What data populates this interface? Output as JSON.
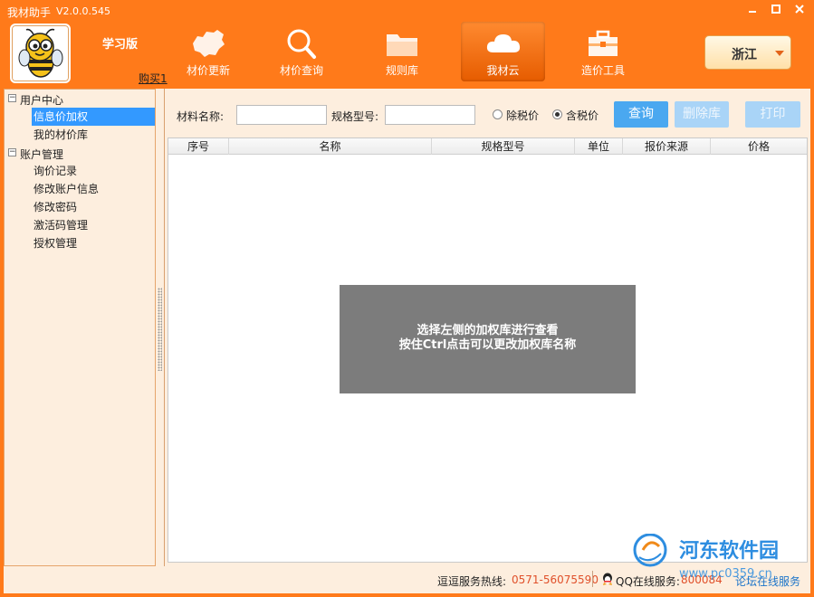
{
  "window": {
    "title": "我材助手",
    "version": "V2.0.0.545"
  },
  "header": {
    "edition": "学习版",
    "buy_link": "购买1",
    "nav": [
      {
        "label": "材价更新",
        "icon": "china-map-icon"
      },
      {
        "label": "材价查询",
        "icon": "magnifier-icon"
      },
      {
        "label": "规则库",
        "icon": "folder-icon"
      },
      {
        "label": "我材云",
        "icon": "cloud-icon",
        "active": true
      },
      {
        "label": "造价工具",
        "icon": "toolbox-icon"
      }
    ],
    "region": "浙江"
  },
  "sidebar": {
    "groups": [
      {
        "label": "用户中心",
        "toggle": "−",
        "items": [
          "信息价加权",
          "我的材价库"
        ],
        "selected_index": 0
      },
      {
        "label": "账户管理",
        "toggle": "−",
        "items": [
          "询价记录",
          "修改账户信息",
          "修改密码",
          "激活码管理",
          "授权管理"
        ]
      }
    ]
  },
  "filters": {
    "material_name_label": "材料名称:",
    "material_name_value": "",
    "spec_label": "规格型号:",
    "spec_value": "",
    "radio_excl_tax": "除税价",
    "radio_incl_tax": "含税价",
    "selected_radio": "含税价",
    "query_button": "查询",
    "delete_button": "删除库",
    "print_button": "打印"
  },
  "grid": {
    "columns": [
      "序号",
      "名称",
      "规格型号",
      "单位",
      "报价来源",
      "价格"
    ],
    "rows": []
  },
  "overlay": {
    "line1": "选择左侧的加权库进行查看",
    "line2": "按住Ctrl点击可以更改加权库名称"
  },
  "status": {
    "hotline_label": "逗逗服务热线:",
    "hotline_number": "0571-56075590",
    "qq_label": "QQ在线服务:",
    "qq_number": "800084",
    "forum_link": "论坛在线服务"
  },
  "watermark": {
    "brand": "河东软件园",
    "site": "www.pc0359.cn"
  },
  "colors": {
    "brand_orange": "#ff7a1a",
    "panel_bg": "#fdeede",
    "selection_blue": "#3399ff",
    "button_blue": "#4aa8f0"
  }
}
